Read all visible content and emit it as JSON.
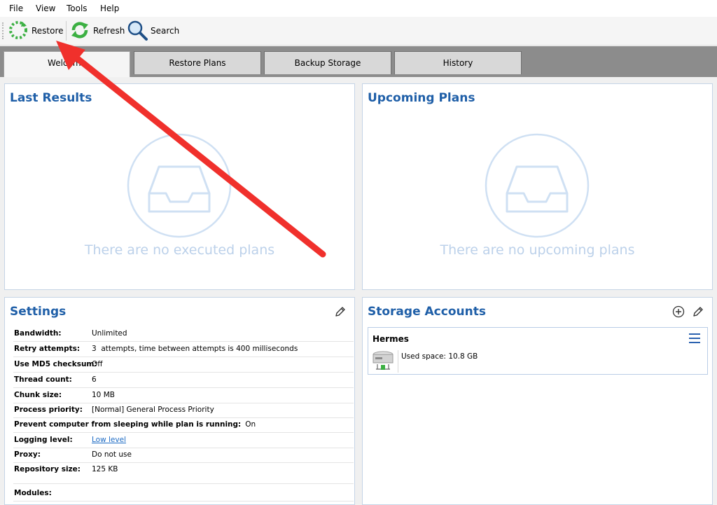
{
  "menu": [
    "File",
    "View",
    "Tools",
    "Help"
  ],
  "toolbar": {
    "restore": "Restore",
    "refresh": "Refresh",
    "search": "Search"
  },
  "tabs": [
    "Welcome",
    "Restore Plans",
    "Backup Storage",
    "History"
  ],
  "last_results": {
    "title": "Last Results",
    "empty": "There are no executed plans"
  },
  "upcoming": {
    "title": "Upcoming Plans",
    "empty": "There are no upcoming plans"
  },
  "settings": {
    "title": "Settings",
    "rows": [
      {
        "k": "Bandwidth:",
        "v": "Unlimited"
      },
      {
        "k": "Retry attempts:",
        "v": "3  attempts, time between attempts is 400 milliseconds"
      },
      {
        "k": "Use MD5 checksum:",
        "v": "Off"
      },
      {
        "k": "Thread count:",
        "v": "6"
      },
      {
        "k": "Chunk size:",
        "v": "10 MB"
      },
      {
        "k": "Process priority:",
        "v": "[Normal] General Process Priority"
      },
      {
        "k": "Prevent computer from sleeping while plan is running:",
        "v": "On"
      },
      {
        "k": "Logging level:",
        "v": "Low level"
      },
      {
        "k": "Proxy:",
        "v": "Do not use"
      },
      {
        "k": "Repository size:",
        "v": "125 KB"
      },
      {
        "k": "Modules:",
        "v": ""
      }
    ]
  },
  "storage": {
    "title": "Storage Accounts",
    "account": {
      "name": "Hermes",
      "used_label": "Used space:",
      "used_value": "10.8 GB"
    }
  },
  "colors": {
    "title_blue": "#1f5fa8",
    "empty_text": "#bcd1ea",
    "arrow": "#f0302c",
    "refresh_green": "#3cb043"
  }
}
